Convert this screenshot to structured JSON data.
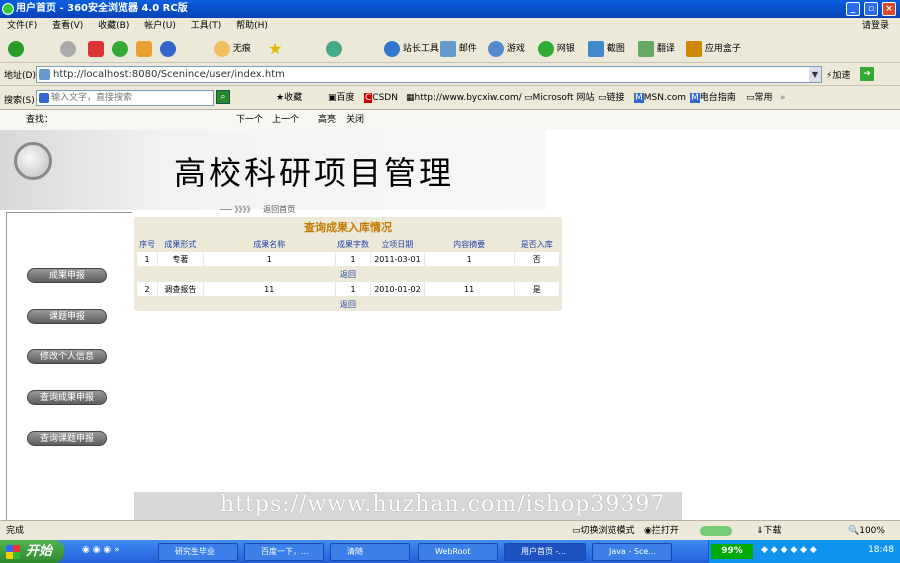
{
  "window": {
    "title": "用户首页 - 360安全浏览器 4.0 RC版",
    "login": "请登录"
  },
  "menu": [
    "文件(F)",
    "查看(V)",
    "收藏(B)",
    "帐户(U)",
    "工具(T)",
    "帮助(H)"
  ],
  "toolbar": {
    "noimage": "无痕",
    "station_tools": "站长工具",
    "mail": "邮件",
    "games": "游戏",
    "netbank": "网银",
    "screenshot": "截图",
    "translate": "翻译",
    "app_box": "应用盒子"
  },
  "address": {
    "label": "地址(D)",
    "url": "http://localhost:8080/Scenince/user/index.htm",
    "go": "加速"
  },
  "searchbar": {
    "label": "搜索(S)",
    "placeholder": "输入文字，直接搜索"
  },
  "favorites": [
    "收藏",
    "百度",
    "CSDN",
    "http://www.bycxiw.com/",
    "Microsoft 网站",
    "链接",
    "MSN.com",
    "电台指南",
    "常用"
  ],
  "findbar": {
    "label": "查找：",
    "next": "下一个",
    "prev": "上一个",
    "highlight": "高亮",
    "close": "关闭"
  },
  "page": {
    "title": "高校科研项目管理",
    "breadcrumb_arrows": "》》》》",
    "breadcrumb": "返回首页",
    "sidebar": [
      "成果申报",
      "课题申报",
      "修改个人信息",
      "查询成果申报",
      "查询课题申报"
    ],
    "panel_title": "查询成果入库情况",
    "columns": [
      "序号",
      "成果形式",
      "成果名称",
      "成果字数",
      "立项日期",
      "内容摘要",
      "是否入库"
    ],
    "rows": [
      {
        "cells": [
          "1",
          "专著",
          "1",
          "1",
          "2011-03-01",
          "1",
          "否"
        ],
        "back": "返回"
      },
      {
        "cells": [
          "2",
          "调查报告",
          "11",
          "1",
          "2010-01-02",
          "11",
          "是"
        ],
        "back": "返回"
      }
    ]
  },
  "watermark": "https://www.huzhan.com/ishop39397",
  "status": {
    "text": "完成",
    "mode": "切换浏览模式",
    "reopen": "拦打开",
    "download": "下载",
    "zoom": "100%"
  },
  "taskbar": {
    "start": "开始",
    "tasks": [
      "研究生毕业",
      "百度一下，...",
      "清随",
      "WebRoot",
      "用户首页 -...",
      "Java - Sce..."
    ],
    "cpu": "99%",
    "time": "18:48"
  }
}
